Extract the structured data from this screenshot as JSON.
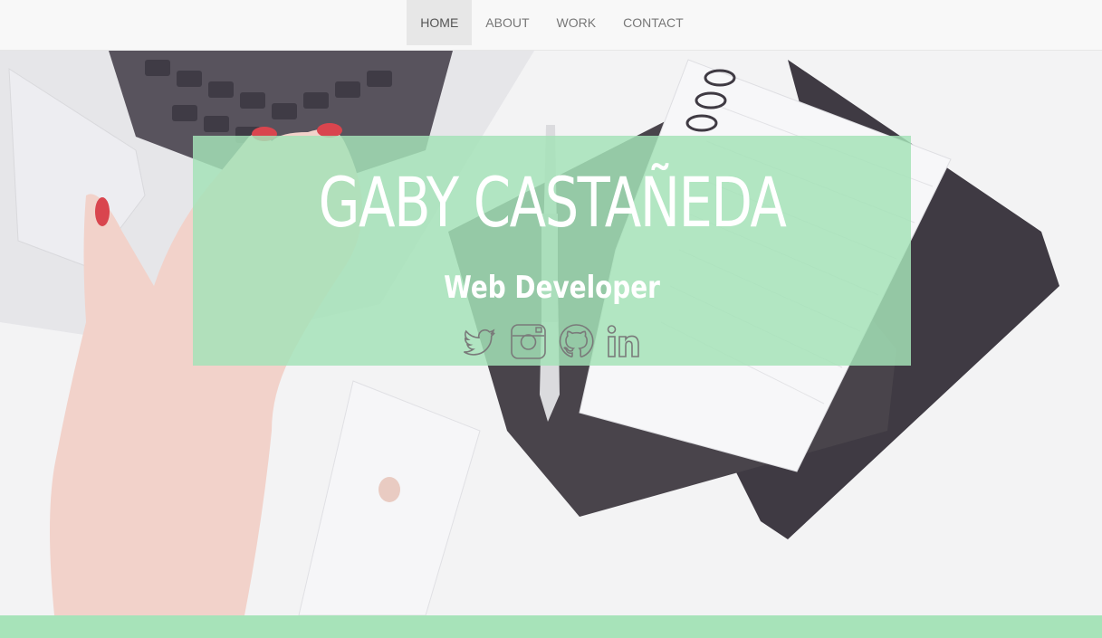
{
  "nav": {
    "items": [
      {
        "label": "HOME",
        "active": true
      },
      {
        "label": "ABOUT",
        "active": false
      },
      {
        "label": "WORK",
        "active": false
      },
      {
        "label": "CONTACT",
        "active": false
      }
    ]
  },
  "hero": {
    "title": "GABY CASTAÑEDA",
    "subtitle": "Web Developer",
    "social": [
      {
        "icon": "twitter-icon"
      },
      {
        "icon": "instagram-icon"
      },
      {
        "icon": "github-icon"
      },
      {
        "icon": "linkedin-icon"
      }
    ]
  },
  "colors": {
    "overlay": "#a4e2b7",
    "footer_bar": "#a7e3b9",
    "nav_bg": "#f8f8f8",
    "nav_active": "#e7e7e7",
    "icon_stroke": "#777777"
  }
}
